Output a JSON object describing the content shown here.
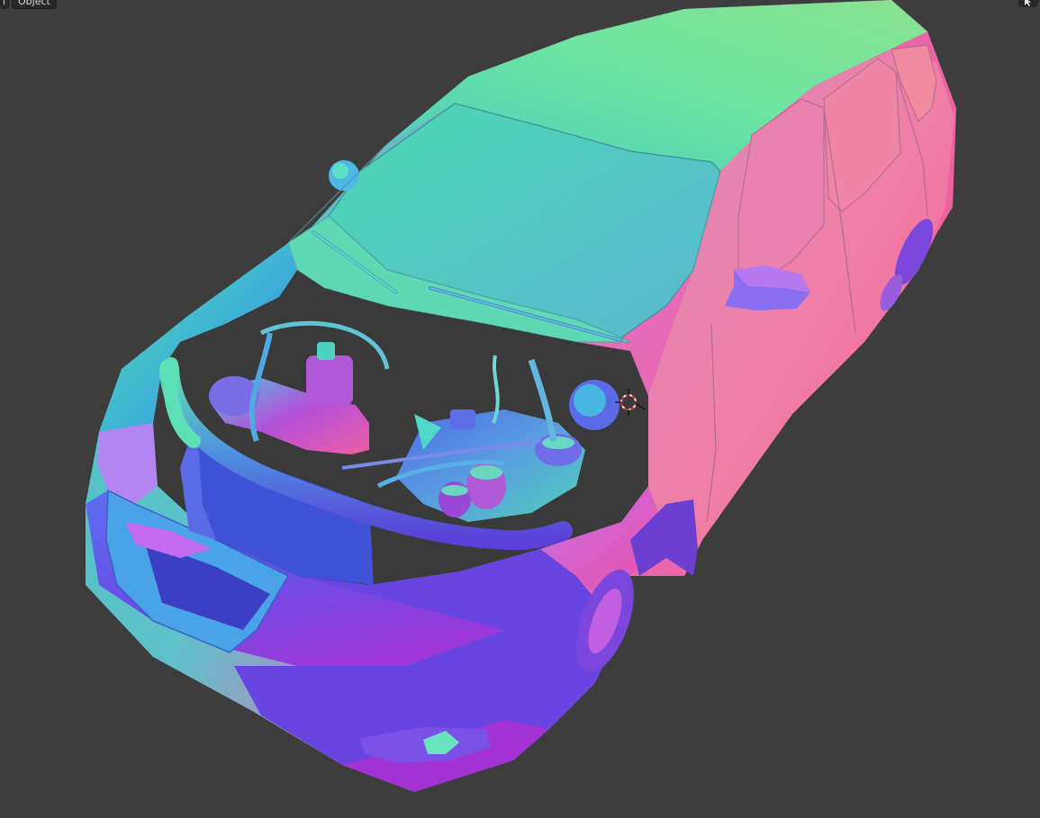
{
  "header": {
    "mode_label": "l",
    "object_menu_label": "Object"
  },
  "viewport": {
    "background": "#3d3d3d",
    "object": "suv-car-model",
    "shading": "normal-map"
  },
  "icons": {
    "select": "cursor-arrow-icon",
    "origin": "3d-cursor-icon"
  },
  "colors": {
    "green": "#6fe6a0",
    "teal": "#55c6c6",
    "blue": "#4f63e6",
    "purple": "#9a3fe0",
    "pink": "#ee6fa5",
    "cursor_red": "#e23b2b"
  }
}
